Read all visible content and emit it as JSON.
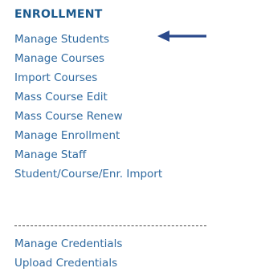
{
  "colors": {
    "heading": "#1b5a8e",
    "link": "#2f6aa0",
    "arrow": "#2b4a8c"
  },
  "section": {
    "title": "ENROLLMENT"
  },
  "menu": {
    "items": [
      {
        "label": "Manage Students"
      },
      {
        "label": "Manage Courses"
      },
      {
        "label": "Import Courses"
      },
      {
        "label": "Mass Course Edit"
      },
      {
        "label": "Mass Course Renew"
      },
      {
        "label": "Manage Enrollment"
      },
      {
        "label": "Manage Staff"
      },
      {
        "label": "Student/Course/Enr. Import"
      }
    ],
    "items_after_divider": [
      {
        "label": "Manage Credentials"
      },
      {
        "label": "Upload Credentials"
      }
    ]
  },
  "annotation": {
    "icon": "left-arrow-icon",
    "points_to": "Manage Students"
  }
}
